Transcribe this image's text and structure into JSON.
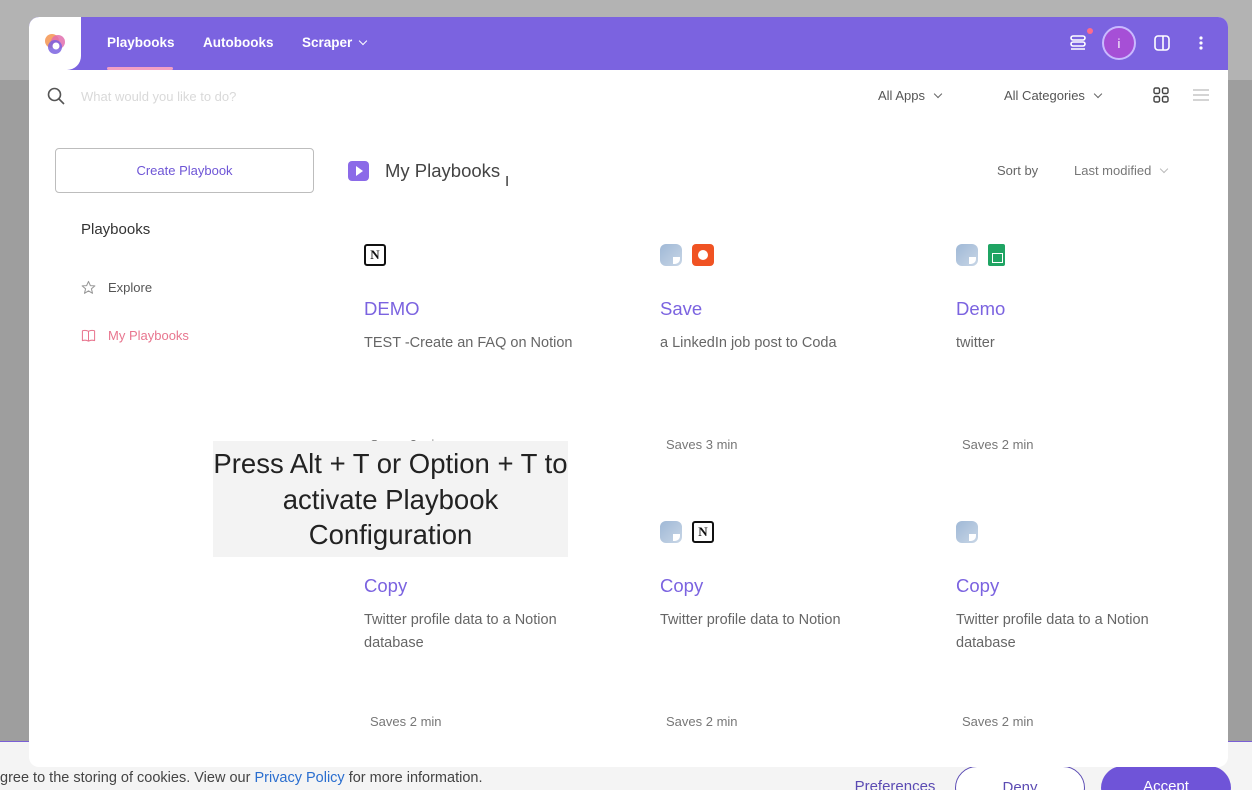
{
  "cookie": {
    "text_before": "gree to the storing of cookies. View our ",
    "link": "Privacy Policy",
    "text_after": " for more information.",
    "preferences": "Preferences",
    "deny": "Deny",
    "accept": "Accept"
  },
  "topbar": {
    "tabs": [
      {
        "label": "Playbooks",
        "active": true
      },
      {
        "label": "Autobooks",
        "active": false
      },
      {
        "label": "Scraper",
        "active": false
      }
    ],
    "avatar_initial": "i"
  },
  "search": {
    "placeholder": "What would you like to do?",
    "apps_filter": "All Apps",
    "categories_filter": "All Categories"
  },
  "sidebar": {
    "create_button": "Create Playbook",
    "heading": "Playbooks",
    "items": [
      {
        "label": "Explore",
        "icon": "star-icon"
      },
      {
        "label": "My Playbooks",
        "icon": "book-icon",
        "active": true
      }
    ]
  },
  "main": {
    "title": "My Playbooks",
    "sort_label": "Sort by",
    "sort_value": "Last modified",
    "cards": [
      {
        "title": "DEMO",
        "desc": "TEST -Create an FAQ on Notion",
        "saves": "Saves 2 min",
        "icons": [
          "notion-icon"
        ]
      },
      {
        "title": "Save",
        "desc": "a LinkedIn job post to Coda",
        "saves": "Saves 3 min",
        "icons": [
          "app-icon",
          "coda-icon"
        ]
      },
      {
        "title": "Demo",
        "desc": "twitter",
        "saves": "Saves 2 min",
        "icons": [
          "app-icon",
          "google-sheets-icon"
        ]
      },
      {
        "title": "Copy",
        "desc": "Twitter profile data to a Notion database",
        "saves": "Saves 2 min",
        "icons": []
      },
      {
        "title": "Copy",
        "desc": "Twitter profile data to Notion",
        "saves": "Saves 2 min",
        "icons": [
          "app-icon",
          "notion-icon"
        ]
      },
      {
        "title": "Copy",
        "desc": "Twitter profile data to a Notion database",
        "saves": "Saves 2 min",
        "icons": [
          "app-icon"
        ]
      }
    ]
  },
  "tooltip": {
    "text": "Press Alt + T or Option + T to activate Playbook Configuration"
  },
  "colors": {
    "accent": "#7b63e0",
    "active_sidebar": "#e8768f",
    "notification_dot": "#ff6b8a"
  }
}
